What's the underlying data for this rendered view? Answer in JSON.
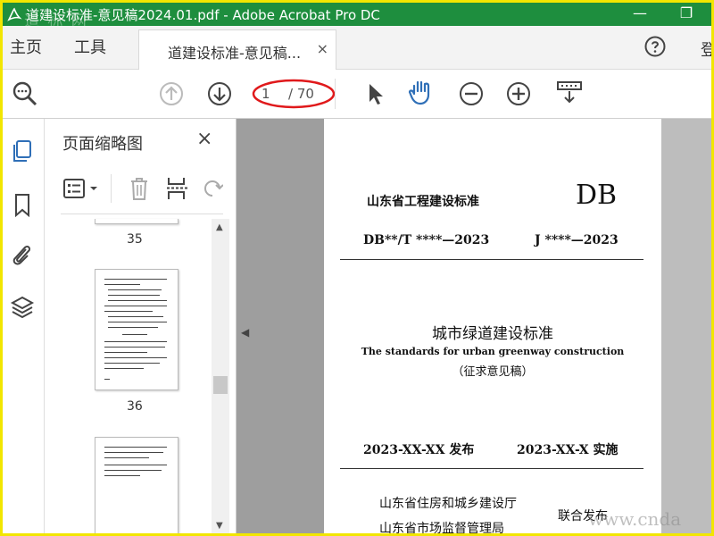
{
  "window": {
    "title": "道建设标准-意见稿2024.01.pdf - Adobe Acrobat Pro DC",
    "watermark": "道 标 网",
    "minimize": "—",
    "restore": "❐"
  },
  "menubar": {
    "home": "主页",
    "tools": "工具",
    "tab_label": "道建设标准-意见稿...",
    "tab_close": "×",
    "login": "登"
  },
  "toolbar": {
    "current_page": "1",
    "total_pages": "/ 70"
  },
  "thumbnails_panel": {
    "title": "页面缩略图",
    "close": "×",
    "pages": [
      {
        "label": "35"
      },
      {
        "label": "36"
      }
    ]
  },
  "document": {
    "issuer_header": "山东省工程建设标准",
    "db_mark": "DB",
    "db_code": "DB**/T ****—2023",
    "j_code": "J ****—2023",
    "title_cn": "城市绿道建设标准",
    "title_en": "The standards for urban greenway construction",
    "draft_note": "（征求意见稿）",
    "publish_date": "2023-XX-XX 发布",
    "implement_date": "2023-XX-X 实施",
    "issuer_1": "山东省住房和城乡建设厅",
    "issuer_2": "山东省市场监督管理局",
    "joint_issue": "联合发布"
  },
  "corner_watermark": "www.cnda",
  "colors": {
    "titlebar": "#1e8e3e",
    "highlight_circle": "#e0191b",
    "toolbar_blue": "#2f6fb7",
    "frame_border": "#f2e600"
  }
}
